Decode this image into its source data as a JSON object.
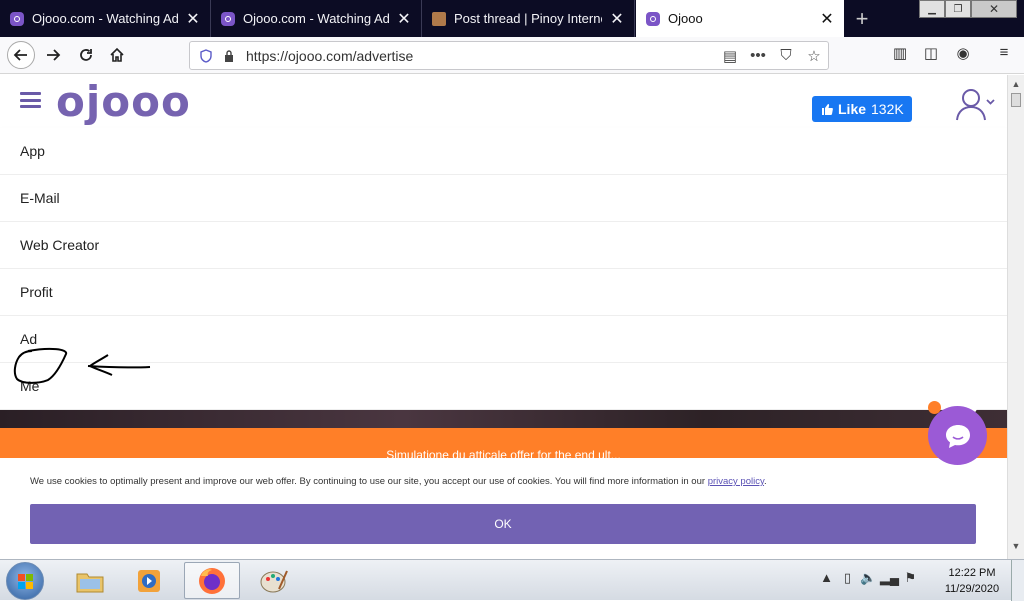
{
  "tabs": [
    {
      "title": "Ojooo.com - Watching Ad -",
      "favicon": "ojooo-icon",
      "active": false
    },
    {
      "title": "Ojooo.com - Watching Ad -",
      "favicon": "ojooo-icon",
      "active": false
    },
    {
      "title": "Post thread | Pinoy Internet a",
      "favicon": "box-icon",
      "active": false
    },
    {
      "title": "Ojooo",
      "favicon": "ojooo-icon",
      "active": true
    }
  ],
  "tab_close_glyph": "✕",
  "new_tab_glyph": "+",
  "address": {
    "url": "https://ojooo.com/advertise"
  },
  "site": {
    "logo": "ojooo",
    "like_label": "Like",
    "like_count": "132K",
    "menu": [
      "App",
      "E-Mail",
      "Web Creator",
      "Profit",
      "Ad",
      "Me"
    ],
    "orange_band_text": "Simulatione du atticale offer for the end ult..."
  },
  "cookie": {
    "text": "We use cookies to optimally present and improve our web offer. By continuing to use our site, you accept our use of cookies. You will find more information in our ",
    "link": "privacy policy",
    "suffix": ".",
    "ok": "OK"
  },
  "taskbar": {
    "time": "12:22 PM",
    "date": "11/29/2020"
  },
  "colors": {
    "brand_purple": "#7663b0",
    "orange": "#ff7f28",
    "facebook_blue": "#1877f2",
    "tab_bar": "#0c0c24"
  }
}
